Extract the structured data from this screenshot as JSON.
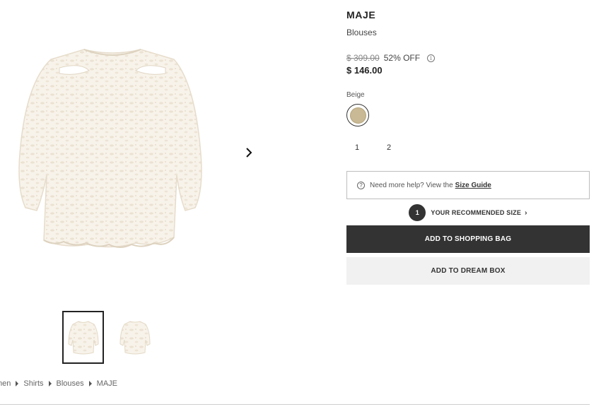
{
  "product": {
    "brand": "MAJE",
    "category": "Blouses",
    "original_price": "$ 309.00",
    "discount": "52% OFF",
    "price": "$ 146.00",
    "color_name": "Beige",
    "color_hex": "#c9b994",
    "sizes": [
      "1",
      "2"
    ]
  },
  "icons": {
    "info": "i",
    "help": "?",
    "next": "chevron-right-icon"
  },
  "help": {
    "text": "Need more help? View the",
    "link": "Size Guide"
  },
  "recommendation": {
    "badge": "1",
    "label": "YOUR RECOMMENDED SIZE",
    "chevron": "›"
  },
  "actions": {
    "add_to_bag": "ADD TO SHOPPING BAG",
    "add_to_dream_box": "ADD TO DREAM BOX"
  },
  "breadcrumb": [
    "men",
    "Shirts",
    "Blouses",
    "MAJE"
  ],
  "colors": {
    "primary_button": "#333333",
    "secondary_button": "#f1f1f1",
    "garment": "#f7f1e8"
  }
}
